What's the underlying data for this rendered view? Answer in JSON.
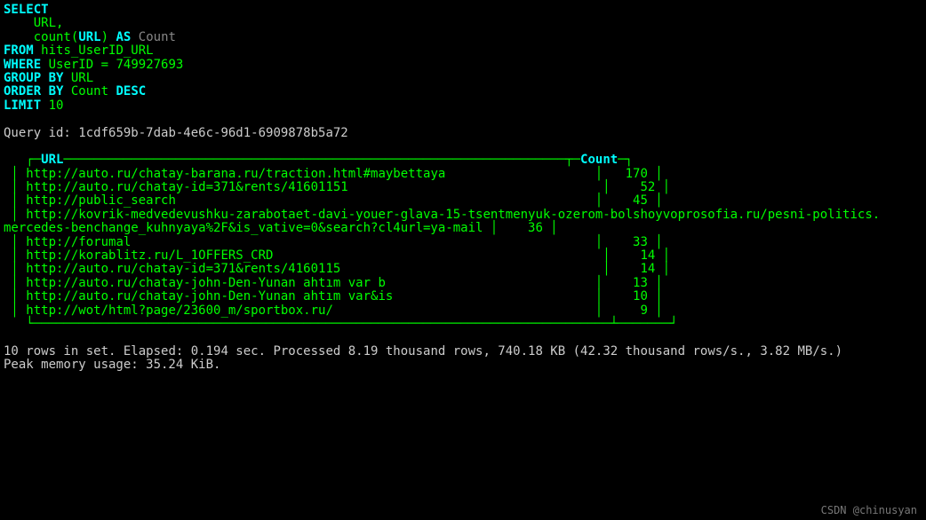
{
  "query": {
    "select_kw": "SELECT",
    "col1": "URL",
    "comma": ",",
    "count_fn": "count",
    "lparen": "(",
    "count_arg": "URL",
    "rparen": ")",
    "as_kw": "AS",
    "alias": "Count",
    "from_kw": "FROM",
    "table": "hits_UserID_URL",
    "where_kw": "WHERE",
    "where_col": "UserID",
    "eq": "=",
    "where_val": "749927693",
    "groupby_kw": "GROUP BY",
    "groupby_col": "URL",
    "orderby_kw": "ORDER BY",
    "orderby_col": "Count",
    "desc_kw": "DESC",
    "limit_kw": "LIMIT",
    "limit_val": "10"
  },
  "query_id_label": "Query id:",
  "query_id": "1cdf659b-7dab-4e6c-96d1-6909878b5a72",
  "cols": {
    "c1": "URL",
    "c2": "Count"
  },
  "chart_data": {
    "type": "table",
    "columns": [
      "URL",
      "Count"
    ],
    "rows": [
      {
        "url": "http://auto.ru/chatay-barana.ru/traction.html#maybettaya",
        "count": 170
      },
      {
        "url": "http://auto.ru/chatay-id=371&rents/41601151",
        "count": 52
      },
      {
        "url": "http://public_search",
        "count": 45
      },
      {
        "url": "http://kovrik-medvedevushku-zarabotaet-davi-youer-glava-15-tsentmenyuk-ozerom-bolshoyvoprosofia.ru/pesni-politics.mercedes-benchange_kuhnyaya%2F&is_vative=0&search?cl4url=ya-mail",
        "count": 36
      },
      {
        "url": "http://forumal",
        "count": 33
      },
      {
        "url": "http://korablitz.ru/L_1OFFERS_CRD",
        "count": 14
      },
      {
        "url": "http://auto.ru/chatay-id=371&rents/4160115",
        "count": 14
      },
      {
        "url": "http://auto.ru/chatay-john-Den-Yunan ahtım var b",
        "count": 13
      },
      {
        "url": "http://auto.ru/chatay-john-Den-Yunan ahtım var&is",
        "count": 10
      },
      {
        "url": "http://wot/html?page/23600_m/sportbox.ru/",
        "count": 9
      }
    ]
  },
  "r": {
    "0": {
      "u": "http://auto.ru/chatay-barana.ru/traction.html#maybettaya",
      "c": "170"
    },
    "1": {
      "u": "http://auto.ru/chatay-id=371&rents/41601151",
      "c": "52"
    },
    "2": {
      "u": "http://public_search",
      "c": "45"
    },
    "3a": {
      "u": "http://kovrik-medvedevushku-zarabotaet-davi-youer-glava-15-tsentmenyuk-ozerom-bolshoyvoprosofia.ru/pesni-politics."
    },
    "3b": {
      "u": "mercedes-benchange_kuhnyaya%2F&is_vative=0&search?cl4url=ya-mail",
      "c": "36"
    },
    "4": {
      "u": "http://forumal",
      "c": "33"
    },
    "5": {
      "u": "http://korablitz.ru/L_1OFFERS_CRD",
      "c": "14"
    },
    "6": {
      "u": "http://auto.ru/chatay-id=371&rents/4160115",
      "c": "14"
    },
    "7": {
      "u": "http://auto.ru/chatay-john-Den-Yunan ahtım var b",
      "c": "13"
    },
    "8": {
      "u": "http://auto.ru/chatay-john-Den-Yunan ahtım var&is",
      "c": "10"
    },
    "9": {
      "u": "http://wot/html?page/23600_m/sportbox.ru/",
      "c": "9"
    }
  },
  "footer": {
    "line1a": "10 rows in set.",
    "line1b": "Elapsed: 0.194 sec. Processed 8.19 thousand rows, 740.18 KB (42.32 thousand rows/s., 3.82 MB/s.)",
    "line2": "Peak memory usage: 35.24 KiB."
  },
  "watermark": "CSDN @chinusyan"
}
